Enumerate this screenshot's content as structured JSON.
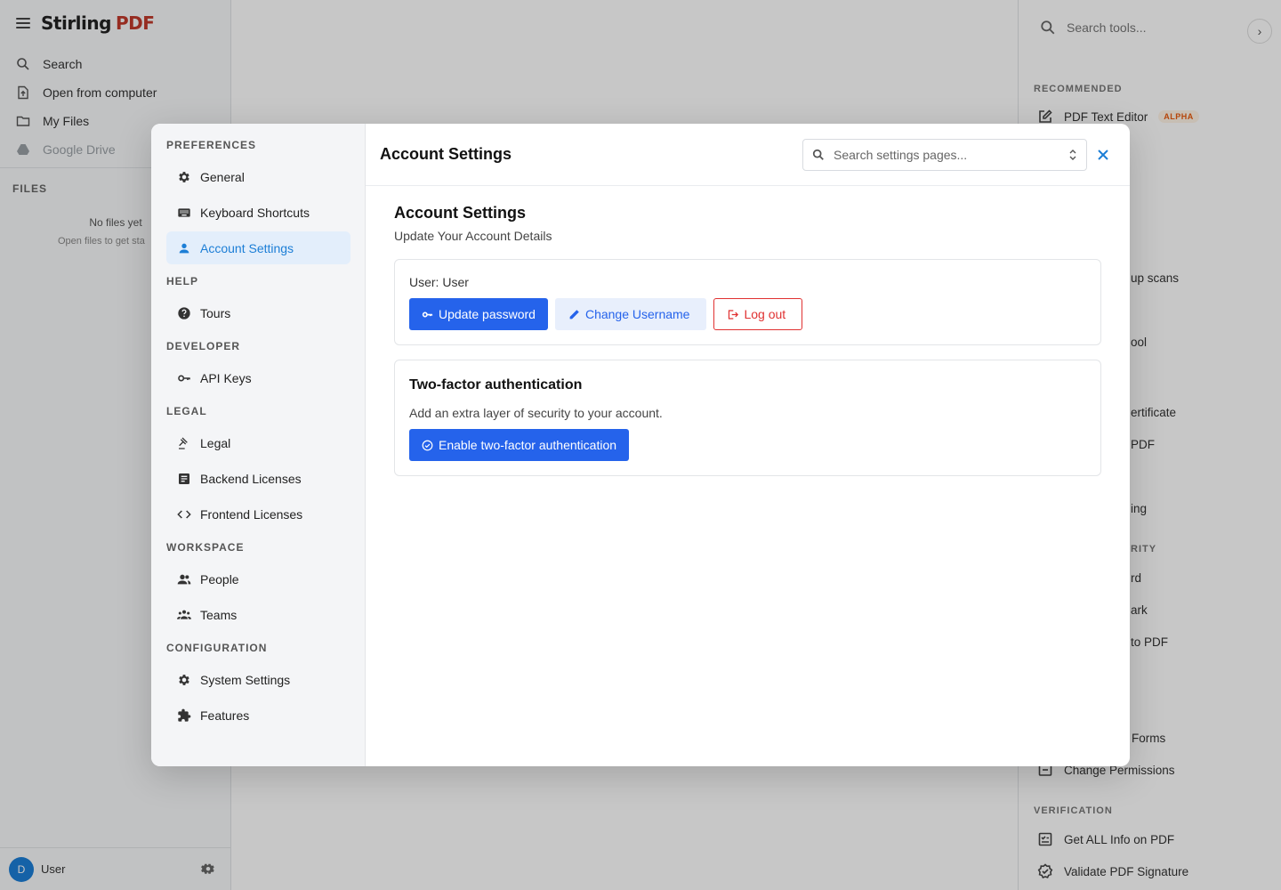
{
  "app": {
    "logo_main": "Stirling",
    "logo_accent": "PDF",
    "nav": [
      {
        "label": "Search",
        "icon": "search-icon"
      },
      {
        "label": "Open from computer",
        "icon": "upload-file-icon"
      },
      {
        "label": "My Files",
        "icon": "folder-icon"
      },
      {
        "label": "Google Drive",
        "icon": "google-drive-icon"
      }
    ],
    "files_label": "FILES",
    "no_files": "No files yet",
    "no_files_sub": "Open files to get sta",
    "user_initial": "D",
    "user_name": "User"
  },
  "tools_panel": {
    "search_placeholder": "Search tools...",
    "recommended_label": "RECOMMENDED",
    "pdf_text_editor": "PDF Text Editor",
    "alpha_badge": "ALPHA",
    "partial_1": "up scans",
    "partial_2": "ool",
    "partial_3": "ertificate",
    "partial_4": "PDF",
    "partial_5": "ing",
    "partial_6": "RITY",
    "partial_7": "rd",
    "partial_8": "ark",
    "partial_9": "to PDF",
    "partial_10": "Forms",
    "change_permissions": "Change Permissions",
    "verification_label": "VERIFICATION",
    "get_all_info": "Get ALL Info on PDF",
    "validate_signature": "Validate PDF Signature"
  },
  "modal": {
    "groups": [
      {
        "label": "PREFERENCES",
        "items": [
          {
            "label": "General",
            "icon": "gear-icon"
          },
          {
            "label": "Keyboard Shortcuts",
            "icon": "keyboard-icon"
          },
          {
            "label": "Account Settings",
            "icon": "person-icon",
            "active": true
          }
        ]
      },
      {
        "label": "HELP",
        "items": [
          {
            "label": "Tours",
            "icon": "help-circle-icon"
          }
        ]
      },
      {
        "label": "DEVELOPER",
        "items": [
          {
            "label": "API Keys",
            "icon": "key-icon"
          }
        ]
      },
      {
        "label": "LEGAL",
        "items": [
          {
            "label": "Legal",
            "icon": "gavel-icon"
          },
          {
            "label": "Backend Licenses",
            "icon": "document-icon"
          },
          {
            "label": "Frontend Licenses",
            "icon": "code-icon"
          }
        ]
      },
      {
        "label": "WORKSPACE",
        "items": [
          {
            "label": "People",
            "icon": "people-icon"
          },
          {
            "label": "Teams",
            "icon": "teams-icon"
          }
        ]
      },
      {
        "label": "CONFIGURATION",
        "items": [
          {
            "label": "System Settings",
            "icon": "gear-icon"
          },
          {
            "label": "Features",
            "icon": "puzzle-icon"
          }
        ]
      }
    ],
    "header_title": "Account Settings",
    "search_placeholder": "Search settings pages...",
    "content_title": "Account Settings",
    "content_subtitle": "Update Your Account Details",
    "user_line": "User: User",
    "update_password": "Update password",
    "change_username": "Change Username",
    "log_out": "Log out",
    "twofa_title": "Two-factor authentication",
    "twofa_desc": "Add an extra layer of security to your account.",
    "twofa_button": "Enable two-factor authentication"
  },
  "colors": {
    "accent": "#1c7ed6",
    "primary_button": "#2563eb",
    "danger": "#e03131",
    "overlay": "rgba(0,0,0,0.22)"
  }
}
